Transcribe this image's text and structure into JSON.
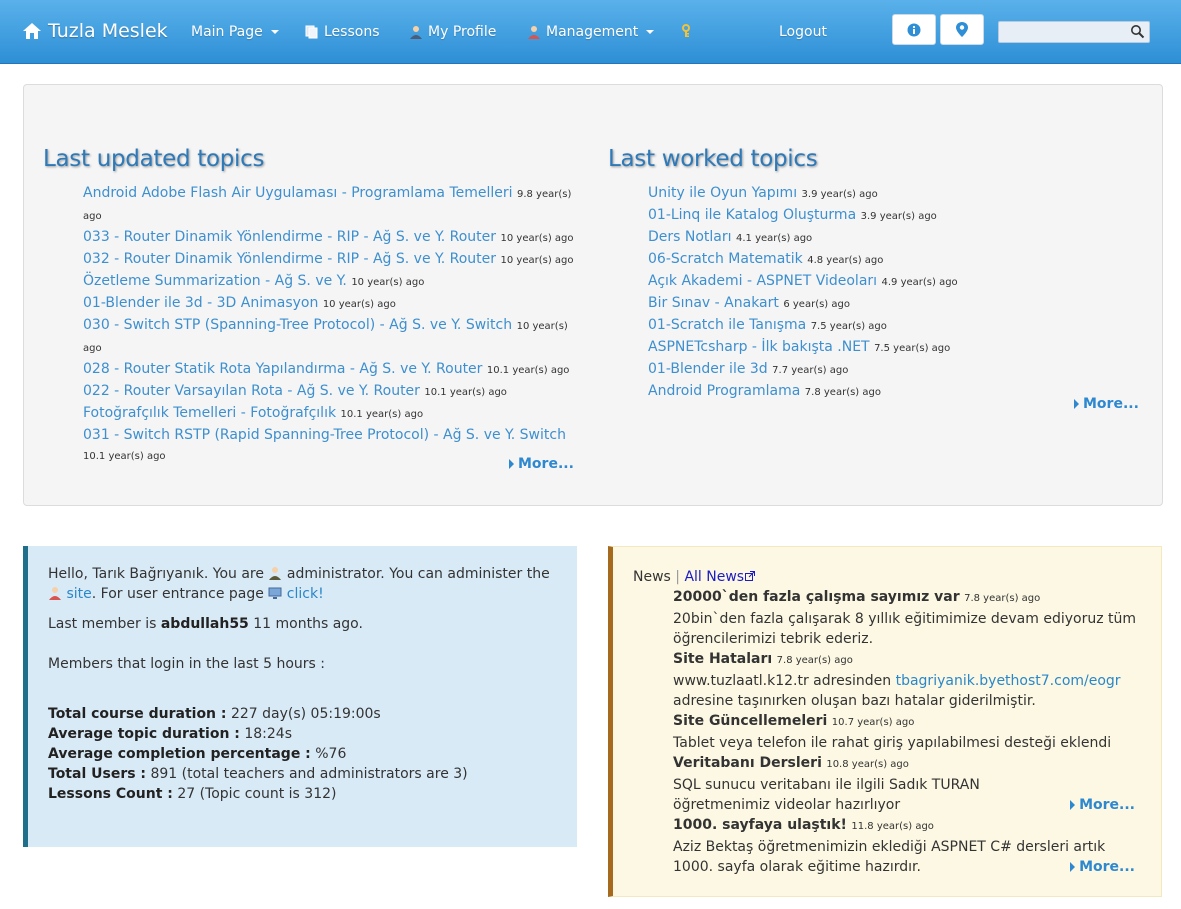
{
  "nav": {
    "brand": "Tuzla Meslek",
    "main_page": "Main Page",
    "lessons": "Lessons",
    "my_profile": "My Profile",
    "management": "Management",
    "logout": "Logout",
    "search_placeholder": ""
  },
  "last_updated": {
    "title": "Last updated topics",
    "items": [
      {
        "title": "Android Adobe Flash Air Uygulaması - Programlama Temelleri",
        "age": "9.8 year(s) ago"
      },
      {
        "title": "033 - Router Dinamik Yönlendirme - RIP - Ağ S. ve Y. Router",
        "age": "10 year(s) ago"
      },
      {
        "title": "032 - Router Dinamik Yönlendirme - RIP - Ağ S. ve Y. Router",
        "age": "10 year(s) ago"
      },
      {
        "title": "Özetleme Summarization - Ağ S. ve Y.",
        "age": "10 year(s) ago"
      },
      {
        "title": "01-Blender ile 3d - 3D Animasyon",
        "age": "10 year(s) ago"
      },
      {
        "title": "030 - Switch STP (Spanning-Tree Protocol) - Ağ S. ve Y. Switch",
        "age": "10 year(s) ago"
      },
      {
        "title": "028 - Router Statik Rota Yapılandırma - Ağ S. ve Y. Router",
        "age": "10.1 year(s) ago"
      },
      {
        "title": "022 - Router Varsayılan Rota - Ağ S. ve Y. Router",
        "age": "10.1 year(s) ago"
      },
      {
        "title": "Fotoğrafçılık Temelleri - Fotoğrafçılık",
        "age": "10.1 year(s) ago"
      },
      {
        "title": "031 - Switch RSTP (Rapid Spanning-Tree Protocol) - Ağ S. ve Y. Switch",
        "age": "10.1 year(s) ago"
      }
    ],
    "more": "More..."
  },
  "last_worked": {
    "title": "Last worked topics",
    "items": [
      {
        "title": "Unity ile Oyun Yapımı",
        "age": "3.9 year(s) ago"
      },
      {
        "title": "01-Linq ile Katalog Oluşturma",
        "age": "3.9 year(s) ago"
      },
      {
        "title": "Ders Notları",
        "age": "4.1 year(s) ago"
      },
      {
        "title": "06-Scratch Matematik",
        "age": "4.8 year(s) ago"
      },
      {
        "title": "Açık Akademi - ASPNET Videoları",
        "age": "4.9 year(s) ago"
      },
      {
        "title": "Bir Sınav - Anakart",
        "age": "6 year(s) ago"
      },
      {
        "title": "01-Scratch ile Tanışma",
        "age": "7.5 year(s) ago"
      },
      {
        "title": "ASPNETcsharp - İlk bakışta .NET",
        "age": "7.5 year(s) ago"
      },
      {
        "title": "01-Blender ile 3d",
        "age": "7.7 year(s) ago"
      },
      {
        "title": "Android Programlama",
        "age": "7.8 year(s) ago"
      }
    ],
    "more": "More..."
  },
  "stats": {
    "greeting_a": "Hello, Tarık Bağrıyanık. You are",
    "greeting_b": "administrator. You can administer the",
    "site_link": "site",
    "greeting_c": ". For user entrance page",
    "click_link": "click!",
    "last_member_label": "Last member is",
    "last_member_name": "abdullah55",
    "last_member_when": "11 months ago.",
    "login_label": "Members that login in the last 5 hours :",
    "rows": [
      {
        "label": "Total course duration :",
        "value": "227 day(s) 05:19:00s"
      },
      {
        "label": "Average topic duration :",
        "value": "18:24s"
      },
      {
        "label": "Average completion percentage :",
        "value": "%76"
      },
      {
        "label": "Total Users :",
        "value": "891 (total teachers and administrators are 3)"
      },
      {
        "label": "Lessons Count :",
        "value": "27 (Topic count is 312)"
      }
    ]
  },
  "news": {
    "label": "News",
    "sep": "|",
    "all_news": "All News",
    "items": [
      {
        "title": "20000`den fazla çalışma sayımız var",
        "age": "7.8 year(s) ago",
        "body": "20bin`den fazla çalışarak 8 yıllık eğitimimize devam ediyoruz tüm öğrencilerimizi tebrik ederiz."
      },
      {
        "title": "Site Hataları",
        "age": "7.8 year(s) ago",
        "body_a": "www.tuzlaatl.k12.tr adresinden",
        "body_link": "tbagriyanik.byethost7.com/eogr",
        "body_b": "adresine taşınırken oluşan bazı hatalar giderilmiştir."
      },
      {
        "title": "Site Güncellemeleri",
        "age": "10.7 year(s) ago",
        "body": "Tablet veya telefon ile rahat giriş yapılabilmesi desteği eklendi"
      },
      {
        "title": "Veritabanı Dersleri",
        "age": "10.8 year(s) ago",
        "body": "SQL sunucu veritabanı ile ilgili Sadık TURAN öğretmenimiz videolar hazırlıyor"
      },
      {
        "title": "1000. sayfaya ulaştık!",
        "age": "11.8 year(s) ago",
        "body": "Aziz Bektaş öğretmenimizin eklediği ASPNET C# dersleri artık 1000. sayfa olarak eğitime hazırdır."
      }
    ],
    "more_1": "More...",
    "more_2": "More..."
  }
}
